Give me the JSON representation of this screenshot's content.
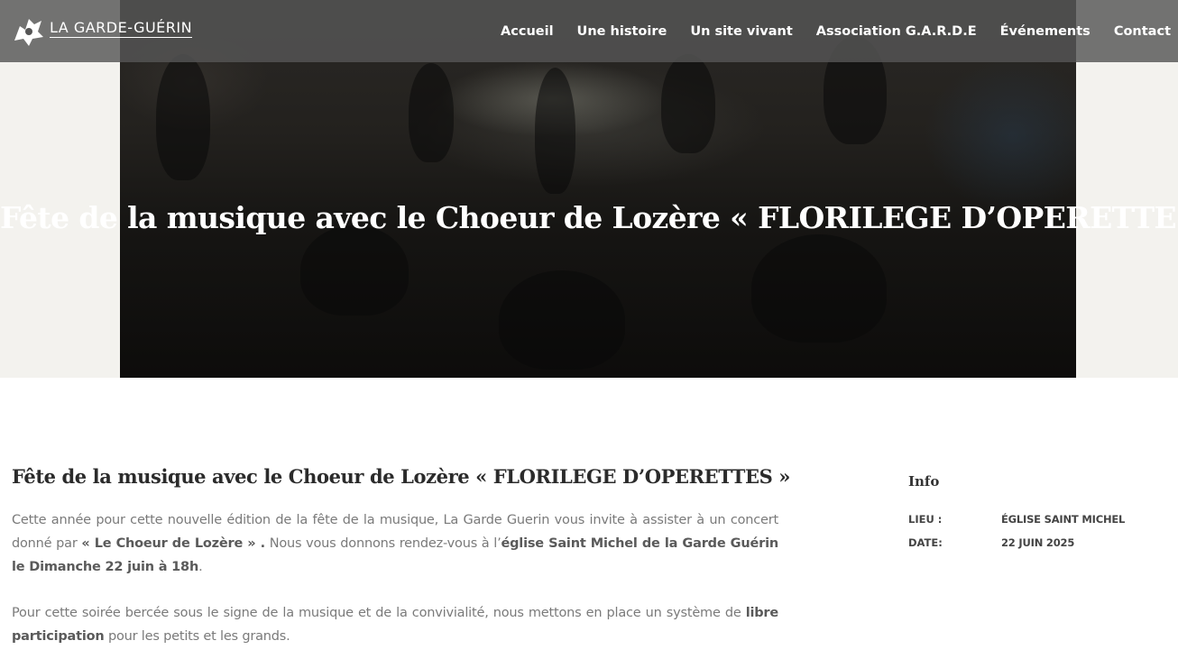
{
  "header": {
    "logo_text": "LA GARDE-GUÉRIN",
    "nav": [
      "Accueil",
      "Une histoire",
      "Un site vivant",
      "Association G.A.R.D.E",
      "Événements",
      "Contact"
    ]
  },
  "hero": {
    "title": "Fête de la musique avec le Choeur de Lozère « FLORILEGE D’OPERETTES »"
  },
  "post": {
    "title": "Fête de la musique avec le Choeur de Lozère « FLORILEGE D’OPERETTES »",
    "p1_a": "Cette année pour cette nouvelle édition de la fête de la musique, La Garde Guerin vous invite à assister à un  concert donné par ",
    "p1_b": "« Le Choeur de Lozère » .",
    "p1_c": " Nous vous donnons rendez-vous à l’",
    "p1_d": "église Saint Michel de la Garde Guérin le Dimanche 22 juin  à 18h",
    "p1_e": ".",
    "p2_a": "Pour cette soirée bercée sous le signe de la musique et de la convivialité, nous mettons en place un système de ",
    "p2_b": "libre participation",
    "p2_c": " pour les petits et les grands."
  },
  "sidebar": {
    "title": "Info",
    "rows": [
      {
        "label": "LIEU :",
        "value": "ÉGLISE SAINT MICHEL"
      },
      {
        "label": "DATE:",
        "value": "22 JUIN 2025"
      }
    ]
  }
}
